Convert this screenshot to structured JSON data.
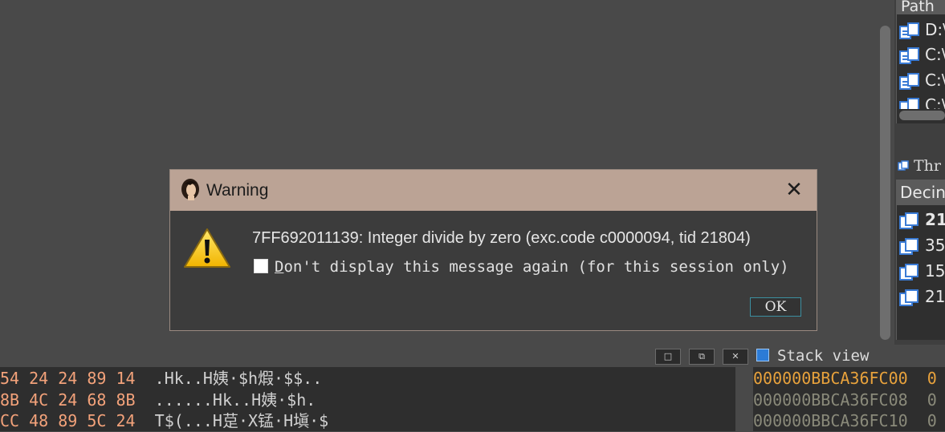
{
  "modules": {
    "header": "Path",
    "rows": [
      "D:\\",
      "C:\\",
      "C:\\",
      "C:\\"
    ]
  },
  "threads": {
    "title": "Thr",
    "header": "Decin",
    "rows": [
      "21",
      "35",
      "15",
      "21"
    ]
  },
  "mini_buttons": [
    "□",
    "⧉",
    "✕"
  ],
  "stack_view_label": "Stack view",
  "hex_dump": [
    {
      "bytes": "54 24 24 89 14  ",
      "ascii": ".Hk..H姨·$h煆·$$.."
    },
    {
      "bytes": "8B 4C 24 68 8B  ",
      "ascii": "......Hk..H姨·$h."
    },
    {
      "bytes": "CC 48 89 5C 24  ",
      "ascii": "T$(...H莡·X锰·H塡·$"
    }
  ],
  "stack_addresses": [
    {
      "addr": "000000BBCA36FC00",
      "suffix": "  0",
      "color": "#e8a23c"
    },
    {
      "addr": "000000BBCA36FC08",
      "suffix": "  0",
      "color": "#8a8a7a"
    },
    {
      "addr": "000000BBCA36FC10",
      "suffix": "  0",
      "color": "#8a8a7a"
    }
  ],
  "dialog": {
    "title": "Warning",
    "message": "7FF692011139: Integer divide by zero (exc.code c0000094, tid 21804)",
    "checkbox_label_mnemonic": "D",
    "checkbox_label_rest": "on't display this message again (for this session only)",
    "checkbox_checked": false,
    "ok_label": "OK",
    "close_glyph": "✕"
  },
  "colors": {
    "titlebar": "#bba395",
    "hex_bytes": "#f3a27a",
    "ok_border": "#3c8fa0"
  }
}
